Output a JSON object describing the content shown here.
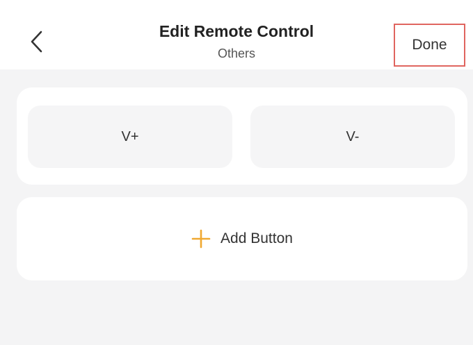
{
  "header": {
    "title": "Edit Remote Control",
    "subtitle": "Others",
    "done_label": "Done",
    "back_icon": "chevron-left-icon"
  },
  "remote_buttons": [
    {
      "label": "V+"
    },
    {
      "label": "V-"
    }
  ],
  "add_button": {
    "label": "Add Button",
    "icon": "plus-icon",
    "icon_color": "#f0a830"
  },
  "colors": {
    "background": "#f4f4f5",
    "card": "#ffffff",
    "key": "#f5f5f6",
    "highlight_border": "#e0655f"
  }
}
